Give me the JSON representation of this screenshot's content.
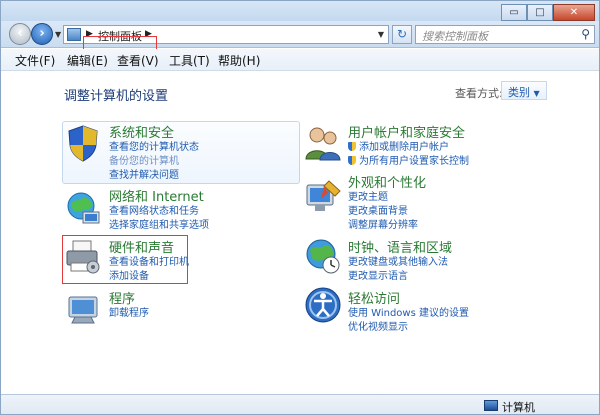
{
  "window": {
    "caption_buttons": [
      "▭",
      "□",
      "✕"
    ]
  },
  "navbar": {
    "breadcrumb": "控制面板",
    "search_placeholder": "搜索控制面板"
  },
  "menu": [
    {
      "label": "文件(F)"
    },
    {
      "label": "编辑(E)"
    },
    {
      "label": "查看(V)"
    },
    {
      "label": "工具(T)"
    },
    {
      "label": "帮助(H)"
    }
  ],
  "content": {
    "title": "调整计算机的设置",
    "view_by_label": "查看方式:",
    "view_by_value": "类别"
  },
  "categories": [
    {
      "name": "系统和安全",
      "icon": "shield-icon",
      "links": [
        "查看您的计算机状态",
        "备份您的计算机",
        "查找并解决问题"
      ]
    },
    {
      "name": "网络和 Internet",
      "icon": "network-icon",
      "links": [
        "查看网络状态和任务",
        "选择家庭组和共享选项"
      ]
    },
    {
      "name": "硬件和声音",
      "icon": "printer-icon",
      "links": [
        "查看设备和打印机",
        "添加设备"
      ]
    },
    {
      "name": "程序",
      "icon": "programs-icon",
      "links": [
        "卸载程序"
      ]
    },
    {
      "name": "用户帐户和家庭安全",
      "icon": "users-icon",
      "links": [
        "添加或删除用户帐户",
        "为所有用户设置家长控制"
      ]
    },
    {
      "name": "外观和个性化",
      "icon": "appearance-icon",
      "links": [
        "更改主题",
        "更改桌面背景",
        "调整屏幕分辨率"
      ]
    },
    {
      "name": "时钟、语言和区域",
      "icon": "globe-clock-icon",
      "links": [
        "更改键盘或其他输入法",
        "更改显示语言"
      ]
    },
    {
      "name": "轻松访问",
      "icon": "ease-of-access-icon",
      "links": [
        "使用 Windows 建议的设置",
        "优化视频显示"
      ]
    }
  ],
  "status": {
    "computer": "计算机"
  }
}
